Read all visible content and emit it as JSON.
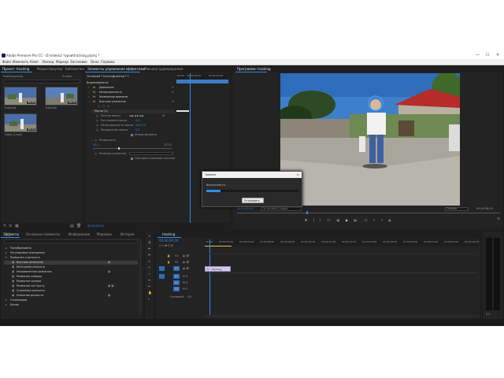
{
  "window": {
    "title": "Adobe Premiere Pro CC - D:\\video\\2 туров\\tracking.prproj *",
    "min": "—",
    "max": "☐",
    "close": "✕"
  },
  "menu": [
    "Файл",
    "Изменить",
    "Клип",
    "Эпизод",
    "Маркер",
    "Заголовок",
    "Окно",
    "Справка"
  ],
  "project_panel": {
    "tabs": [
      "Проект: tracking",
      "Медиа-браузер",
      "Библиотеки"
    ],
    "name": "tracking.prproj",
    "count": "3 элем.",
    "items": [
      {
        "name": "tracking",
        "dur": "38:09"
      },
      {
        "name": "tracking",
        "dur": "38:09"
      },
      {
        "name": "video_2.mp4",
        "dur": "38:09"
      }
    ]
  },
  "effect_controls": {
    "tabs": [
      "Элементы управления эффектами",
      "Микшер аудиодорожек"
    ],
    "source": "Основной * tracking",
    "seq": "tracking * 1",
    "ruler": [
      "00:00",
      "00:00:05:00",
      "00:00:10:00"
    ],
    "section": "Видеоэффекты",
    "rows": [
      "Движение",
      "Непрозрачность",
      "Изменение времени",
      "Быстрое размытие",
      "Маска (1)",
      "Контур маски",
      "Растушевка маски",
      "Непрозрачность маски",
      "Расширение маски",
      "Инвертировано",
      "Размытость",
      "Размеры размытия",
      "Повторить краевые пиксели"
    ],
    "values": [
      "42,0",
      "100,0 %",
      "0,0",
      "0,0",
      "127,0"
    ],
    "bottom_time": "00:00:00:00"
  },
  "program_monitor": {
    "tab": "Программа: tracking",
    "timecode": "00:00:00:00",
    "fit": "По размеру кадра",
    "quality": "Полное",
    "duration": "00:00:38:09"
  },
  "render_dialog": {
    "title": "Трекинг",
    "status": "Выполняется...",
    "progress": 0.15,
    "cancel": "Остановить"
  },
  "effects_panel": {
    "tabs": [
      "Эффекты",
      "Основные элементы",
      "Информация",
      "Маркеры",
      "История"
    ],
    "items": [
      "Преобразовать",
      "Регулировка освещения",
      "Размытие и резкость",
      "Быстрое размытие",
      "Контурная резкость",
      "Направленное размытие",
      "Размытие камеры",
      "Размытие канала",
      "Размытие по Гауссу",
      "Снижение резкости",
      "Усиление резкости",
      "Стилизация",
      "Канал"
    ]
  },
  "timeline": {
    "tabs": [
      "tracking"
    ],
    "timecode": "00:00:00:00",
    "ruler": [
      "00:00",
      "00:00:02:00",
      "00:00:04:00",
      "00:00:06:00",
      "00:00:08:00",
      "00:00:10:00",
      "00:00:12:00",
      "00:00:14:00",
      "00:00:16:00",
      "00:00:18:00",
      "00:00:20:00",
      "00:00:22:00",
      "00:00:24:00",
      "00:00:26:00",
      "00:00:28:00",
      "00:00:30:00",
      "00:00:32:00",
      "00:00:34:00"
    ],
    "tracks": [
      "V3",
      "V2",
      "V1",
      "A1",
      "A2",
      "A3"
    ],
    "master": "Основной",
    "master_val": "0,0",
    "clip": "tracking"
  },
  "colors": {
    "accent": "#2d8ceb",
    "panel": "#232323",
    "clip": "#d4c8e8"
  }
}
